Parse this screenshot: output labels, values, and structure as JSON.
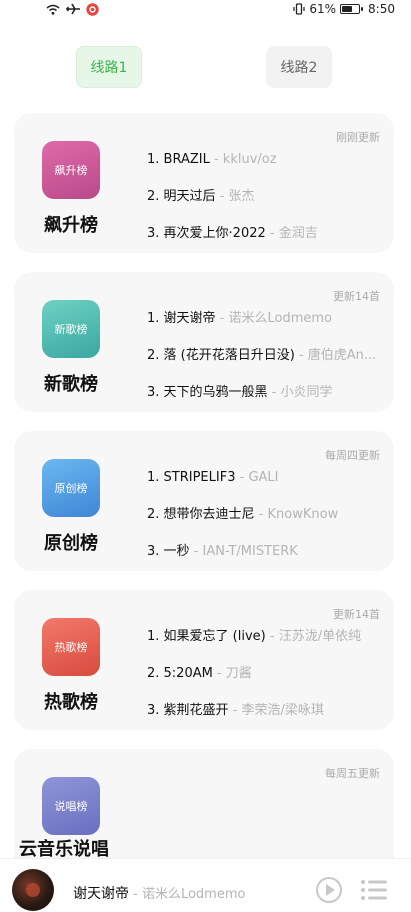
{
  "status_bar": {
    "battery_percent": "61%",
    "battery_level": 0.61,
    "time": "8:50"
  },
  "routes": [
    {
      "label": "线路1",
      "active": true
    },
    {
      "label": "线路2",
      "active": false
    }
  ],
  "charts": [
    {
      "cover_label": "飙升榜",
      "name": "飙升榜",
      "update": "刚刚更新",
      "cover_colors": [
        "#e06aa8",
        "#b84a8a"
      ],
      "tracks": [
        {
          "title": "1. BRAZIL",
          "artist": " - kkluv/oz"
        },
        {
          "title": "2. 明天过后",
          "artist": " - 张杰"
        },
        {
          "title": "3. 再次爱上你·2022",
          "artist": " - 金润吉"
        }
      ]
    },
    {
      "cover_label": "新歌榜",
      "name": "新歌榜",
      "update": "更新14首",
      "cover_colors": [
        "#6ed1c4",
        "#3aa8a0"
      ],
      "tracks": [
        {
          "title": "1. 谢天谢帝",
          "artist": " - 诺米么Lodmemo"
        },
        {
          "title": "2. 落 (花开花落日升日没)",
          "artist": " - 唐伯虎An..."
        },
        {
          "title": "3. 天下的乌鸦一般黑",
          "artist": " - 小炎同学"
        }
      ]
    },
    {
      "cover_label": "原创榜",
      "name": "原创榜",
      "update": "每周四更新",
      "cover_colors": [
        "#6ab8f0",
        "#3f86d6"
      ],
      "tracks": [
        {
          "title": "1. STRIPELIF3",
          "artist": " - GALI"
        },
        {
          "title": "2. 想带你去迪士尼",
          "artist": " - KnowKnow"
        },
        {
          "title": "3. 一秒",
          "artist": " - IAN-T/MISTERK"
        }
      ]
    },
    {
      "cover_label": "热歌榜",
      "name": "热歌榜",
      "update": "更新14首",
      "cover_colors": [
        "#f27a6a",
        "#d84a3e"
      ],
      "tracks": [
        {
          "title": "1. 如果爱忘了 (live)",
          "artist": " - 汪苏泷/单依纯"
        },
        {
          "title": "2. 5:20AM",
          "artist": " - 刀酱"
        },
        {
          "title": "3. 紫荆花盛开",
          "artist": " - 李荣浩/梁咏琪"
        }
      ]
    },
    {
      "cover_label": "说唱榜",
      "name": "云音乐说唱",
      "update": "每周五更新",
      "cover_colors": [
        "#8e96d8",
        "#6a6fbf"
      ],
      "tracks": []
    }
  ],
  "player": {
    "title": "谢天谢帝",
    "artist": " - 诺米么Lodmemo"
  }
}
